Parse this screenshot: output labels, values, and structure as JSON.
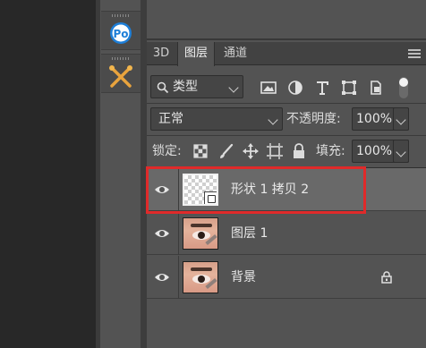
{
  "tabs": [
    {
      "label": "3D"
    },
    {
      "label": "图层"
    },
    {
      "label": "通道"
    }
  ],
  "filter": {
    "kind_label": "类型"
  },
  "blend": {
    "mode": "正常",
    "opacity_label": "不透明度:",
    "opacity_value": "100%"
  },
  "lock_row": {
    "lock_label": "锁定:",
    "fill_label": "填充:",
    "fill_value": "100%"
  },
  "layers": [
    {
      "name": "形状 1 拷贝 2",
      "selected": true,
      "thumbnail": "transparent-checker",
      "smart_object": true
    },
    {
      "name": "图层 1",
      "selected": false,
      "thumbnail": "eye-photo"
    },
    {
      "name": "背景",
      "selected": false,
      "thumbnail": "eye-photo",
      "locked": true
    }
  ],
  "colors": {
    "highlight_border": "#e02a2a",
    "panel_bg": "#535353",
    "selected_row": "#696969"
  },
  "icons": {
    "tool_1": "pr-circle-icon",
    "tool_2": "crossed-brushes-icon"
  }
}
